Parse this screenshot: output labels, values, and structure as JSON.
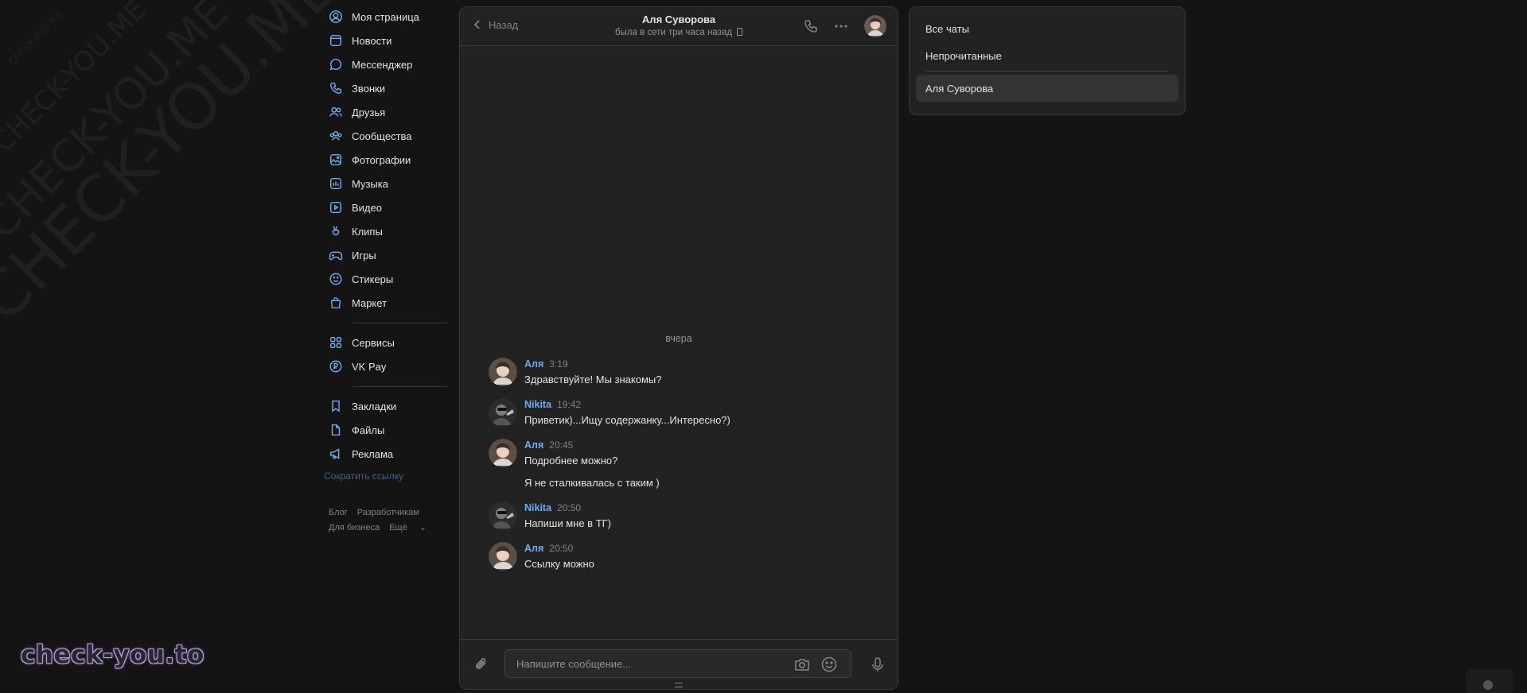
{
  "watermark": {
    "small": "CHECK-YOU.ME",
    "medium": "CHECK-YOU.ME",
    "large": "CHECK-YOU.ME",
    "xlarge": "CHECK-YOU.ME"
  },
  "brand": "check-you.to",
  "nav": {
    "items": [
      {
        "label": "Моя страница",
        "icon": "user-circle-icon"
      },
      {
        "label": "Новости",
        "icon": "news-icon"
      },
      {
        "label": "Мессенджер",
        "icon": "message-icon"
      },
      {
        "label": "Звонки",
        "icon": "phone-icon"
      },
      {
        "label": "Друзья",
        "icon": "friends-icon"
      },
      {
        "label": "Сообщества",
        "icon": "communities-icon"
      },
      {
        "label": "Фотографии",
        "icon": "photo-icon"
      },
      {
        "label": "Музыка",
        "icon": "music-icon"
      },
      {
        "label": "Видео",
        "icon": "video-icon"
      },
      {
        "label": "Клипы",
        "icon": "clips-icon"
      },
      {
        "label": "Игры",
        "icon": "gamepad-icon"
      },
      {
        "label": "Стикеры",
        "icon": "smile-icon"
      },
      {
        "label": "Маркет",
        "icon": "bag-icon"
      }
    ],
    "items2": [
      {
        "label": "Сервисы",
        "icon": "services-icon"
      },
      {
        "label": "VK Pay",
        "icon": "vkpay-icon"
      }
    ],
    "items3": [
      {
        "label": "Закладки",
        "icon": "bookmark-icon"
      },
      {
        "label": "Файлы",
        "icon": "file-icon"
      },
      {
        "label": "Реклама",
        "icon": "megaphone-icon"
      }
    ],
    "short_link": "Сократить ссылку",
    "footer": {
      "blog": "Блог",
      "dev": "Разработчикам",
      "business": "Для бизнеса",
      "more": "Ещё"
    }
  },
  "chat": {
    "back_label": "Назад",
    "peer_name": "Аля Суворова",
    "peer_status": "была в сети три часа назад",
    "date_separator": "вчера",
    "messages": [
      {
        "author": "Аля",
        "time": "3:19",
        "text": "Здравствуйте! Мы знакомы?"
      },
      {
        "author": "Nikita",
        "time": "19:42",
        "text": "Приветик)...Ищу содержанку...Интересно?)"
      },
      {
        "author": "Аля",
        "time": "20:45",
        "text": "Подробнее можно?",
        "followup": "Я не сталкивалась с таким )"
      },
      {
        "author": "Nikita",
        "time": "20:50",
        "text": "Напиши мне в ТГ)"
      },
      {
        "author": "Аля",
        "time": "20:50",
        "text": "Ссылку можно"
      }
    ],
    "compose_placeholder": "Напишите сообщение..."
  },
  "right_panel": {
    "all_chats": "Все чаты",
    "unread": "Непрочитанные",
    "active_chat": "Аля Суворова"
  },
  "colors": {
    "accent": "#71aaeb",
    "background": "#141414",
    "panel": "#222222"
  }
}
